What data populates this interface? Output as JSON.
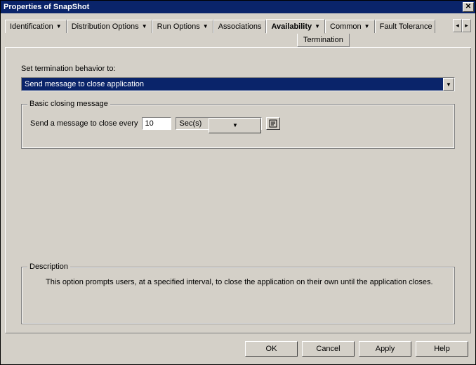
{
  "window": {
    "title": "Properties of SnapShot"
  },
  "tabs": {
    "identification": "Identification",
    "distribution_options": "Distribution Options",
    "run_options": "Run Options",
    "associations": "Associations",
    "availability": "Availability",
    "common": "Common",
    "fault_tolerance": "Fault Tolerance",
    "sub_termination": "Termination"
  },
  "termination": {
    "behavior_label": "Set termination behavior to:",
    "behavior_value": "Send message to close application",
    "closing_group_title": "Basic closing message",
    "send_every_label": "Send a message to close every",
    "interval_value": "10",
    "unit_value": "Sec(s)"
  },
  "description": {
    "title": "Description",
    "text": "This option prompts users, at a specified interval, to close the application on their own until the application closes."
  },
  "buttons": {
    "ok": "OK",
    "cancel": "Cancel",
    "apply": "Apply",
    "help": "Help"
  },
  "glyphs": {
    "dropdown": "▼",
    "left": "◂",
    "right": "▸"
  }
}
